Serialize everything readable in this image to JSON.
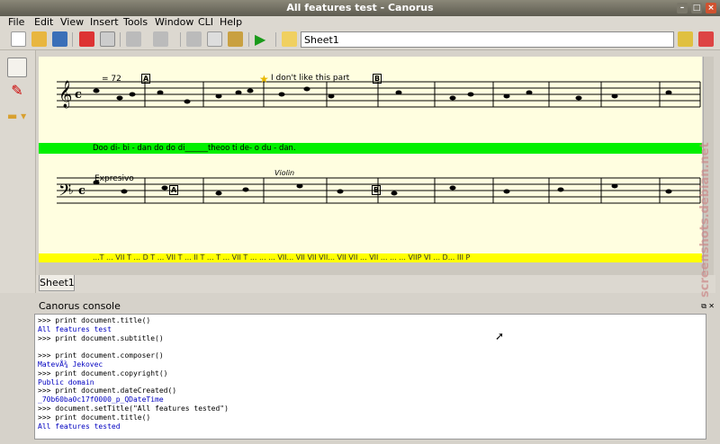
{
  "window": {
    "title": "All features test - Canorus"
  },
  "menubar": {
    "items": [
      "File",
      "Edit",
      "View",
      "Insert",
      "Tools",
      "Window",
      "CLI",
      "Help"
    ]
  },
  "toolbar": {
    "sheet_name": "Sheet1"
  },
  "score": {
    "tempo": "= 72",
    "rehearsal_a": "A",
    "rehearsal_b": "B",
    "annotation": "I don't like this part",
    "lyrics": "Doo di- bi - dan do do di______theoo ti de- o du - dan.",
    "expression": "Expresivo",
    "instrument_change": "Violin",
    "rehearsal_a2": "A",
    "rehearsal_b2": "B",
    "harmony": "...T ... VII T ... D T ... VII T ... II T ... T ... VII T ... ... ... VII... VII VII VII... VII VII ... VII ... ... ... VIIP VI ... D... III P",
    "lyric_band_color": "#00f000",
    "harmony_band_color": "#ffff00"
  },
  "tabs": {
    "active": "Sheet1"
  },
  "console": {
    "title": "Canorus console",
    "lines": [
      {
        "t": ">>> print document.title()",
        "c": "in"
      },
      {
        "t": "All features test",
        "c": "out"
      },
      {
        "t": ">>> print document.subtitle()",
        "c": "in"
      },
      {
        "t": "",
        "c": "out"
      },
      {
        "t": ">>> print document.composer()",
        "c": "in"
      },
      {
        "t": "MatevÅ¾ Jekovec",
        "c": "out"
      },
      {
        "t": ">>> print document.copyright()",
        "c": "in"
      },
      {
        "t": "Public domain",
        "c": "out"
      },
      {
        "t": ">>> print document.dateCreated()",
        "c": "in"
      },
      {
        "t": "_70b60ba0c17f0000_p_QDateTime",
        "c": "out"
      },
      {
        "t": ">>> document.setTitle(\"All features tested\")",
        "c": "in"
      },
      {
        "t": ">>> print document.title()",
        "c": "in"
      },
      {
        "t": "All features tested",
        "c": "out"
      }
    ]
  },
  "watermark": "screenshots.debian.net"
}
